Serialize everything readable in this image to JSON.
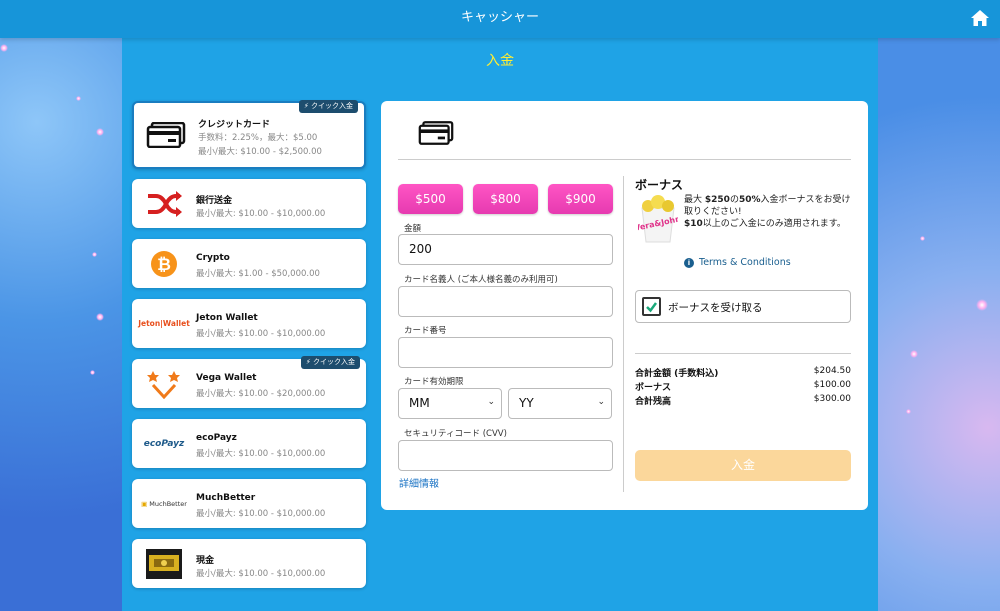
{
  "header": {
    "title": "キャッシャー"
  },
  "page": {
    "section_title": "入金"
  },
  "colors": {
    "accent": "#1fa3e6",
    "amount_button": "#f049bd",
    "deposit_button": "#fbd79b",
    "section_title": "#ffee33"
  },
  "methods": [
    {
      "name": "クレジットカード",
      "line1": "手数料：2.25%，最大：$5.00",
      "line2": "最小/最大: $10.00 - $2,500.00",
      "badge": "クイック入金",
      "icon": "credit-card-icon"
    },
    {
      "name": "銀行送金",
      "line1": "最小/最大: $10.00 - $10,000.00",
      "icon": "bank-transfer-icon"
    },
    {
      "name": "Crypto",
      "line1": "最小/最大: $1.00 - $50,000.00",
      "icon": "bitcoin-icon"
    },
    {
      "name": "Jeton Wallet",
      "line1": "最小/最大: $10.00 - $10,000.00",
      "logo_text": "Jeton|Wallet",
      "icon": "jeton-logo"
    },
    {
      "name": "Vega Wallet",
      "line1": "最小/最大: $10.00 - $20,000.00",
      "badge": "クイック入金",
      "icon": "vega-logo"
    },
    {
      "name": "ecoPayz",
      "line1": "最小/最大: $10.00 - $10,000.00",
      "logo_text": "ecoPayz",
      "icon": "ecopayz-logo"
    },
    {
      "name": "MuchBetter",
      "line1": "最小/最大: $10.00 - $10,000.00",
      "logo_text": "MuchBetter",
      "icon": "muchbetter-logo"
    },
    {
      "name": "現金",
      "line1": "最小/最大: $10.00 - $10,000.00",
      "icon": "cash-icon"
    }
  ],
  "form": {
    "amount_buttons": [
      "$500",
      "$800",
      "$900"
    ],
    "amount_label": "金額",
    "amount_value": "200",
    "cardholder_label": "カード名義人 (ご本人様名義のみ利用可)",
    "card_number_label": "カード番号",
    "expiry_label": "カード有効期限",
    "month_value": "MM",
    "year_value": "YY",
    "cvv_label": "セキュリティコード (CVV)",
    "details_link": "詳細情報"
  },
  "bonus": {
    "title": "ボーナス",
    "text_part1": "最大 ",
    "text_amount": "$250",
    "text_part2": "の",
    "text_percent": "50%",
    "text_part3": "入金ボーナスをお受け取りください!",
    "text_min": "$10",
    "text_part4": "以上のご入金にのみ適用されます。",
    "image_text": "Vera&John",
    "terms_link": "Terms & Conditions",
    "checkbox_label": "ボーナスを受け取る",
    "checkbox_checked": true
  },
  "summary": {
    "rows": [
      {
        "label": "合計金額 (手数料込)",
        "value": "$204.50"
      },
      {
        "label": "ボーナス",
        "value": "$100.00"
      },
      {
        "label": "合計残高",
        "value": "$300.00"
      }
    ],
    "deposit_button": "入金"
  }
}
